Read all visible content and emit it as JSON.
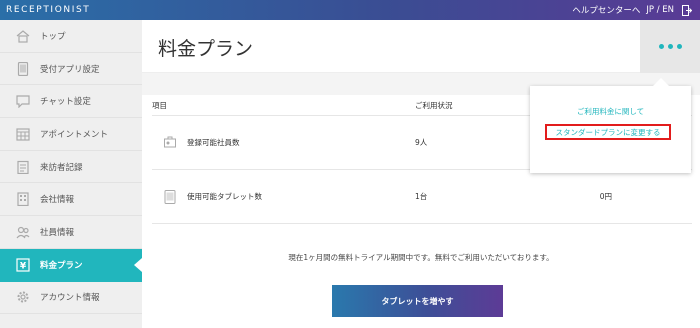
{
  "topbar": {
    "brand": "RECEPTIONIST",
    "help_link": "ヘルプセンターへ",
    "language": "JP / EN",
    "logout_icon": "logout-icon",
    "gradient": [
      "#2a6fa8",
      "#5a3a95"
    ]
  },
  "sidebar": {
    "items": [
      {
        "label": "トップ",
        "icon": "home-icon",
        "active": false
      },
      {
        "label": "受付アプリ設定",
        "icon": "tablet-icon",
        "active": false
      },
      {
        "label": "チャット設定",
        "icon": "chat-icon",
        "active": false
      },
      {
        "label": "アポイントメント",
        "icon": "calendar-icon",
        "active": false
      },
      {
        "label": "来訪者記録",
        "icon": "clipboard-icon",
        "active": false
      },
      {
        "label": "会社情報",
        "icon": "building-icon",
        "active": false
      },
      {
        "label": "社員情報",
        "icon": "people-icon",
        "active": false
      },
      {
        "label": "料金プラン",
        "icon": "yen-icon",
        "active": true
      },
      {
        "label": "アカウント情報",
        "icon": "gear-icon",
        "active": false
      }
    ],
    "active_color": "#21b6bd"
  },
  "main": {
    "title": "料金プラン",
    "more_icon": "more-dots-icon",
    "table": {
      "headers": [
        "項目",
        "ご利用状況"
      ],
      "rows": [
        {
          "icon": "employees-icon",
          "label": "登録可能社員数",
          "usage": "9人",
          "price": ""
        },
        {
          "icon": "tablet-icon",
          "label": "使用可能タブレット数",
          "usage": "1台",
          "price": "0円"
        }
      ]
    },
    "notice": "現在1ヶ月間の無料トライアル期間中です。無料でご利用いただいております。",
    "cta_label": "タブレットを増やす"
  },
  "dropdown": {
    "items": [
      "ご利用料金に関して",
      "スタンダードプランに変更する"
    ],
    "highlight_color": "#e21c1c"
  }
}
